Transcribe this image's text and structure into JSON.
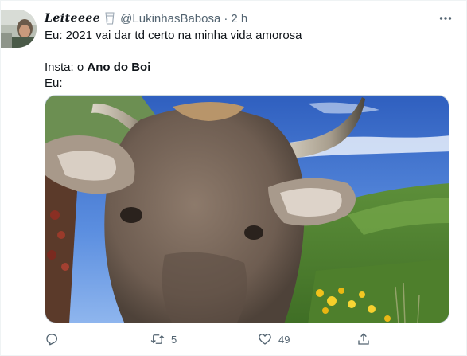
{
  "tweet": {
    "display_name": "Leiteeee",
    "handle": "@LukinhasBabosa",
    "separator": "·",
    "time": "2 h",
    "line1": "Eu: 2021 vai dar td certo na minha vida amorosa",
    "line2_prefix": "Insta: o ",
    "line2_bold": "Ano do Boi",
    "line3": "Eu:"
  },
  "icons": {
    "avatar": "avatar",
    "badge": "milk-cup-icon",
    "more": "more-horizontal-icon",
    "reply": "reply-icon",
    "retweet": "retweet-icon",
    "like": "heart-icon",
    "share": "share-icon"
  },
  "actions": {
    "reply_count": "",
    "retweet_count": "5",
    "like_count": "49"
  },
  "colors": {
    "text": "#0f1419",
    "secondary": "#536471",
    "border": "#eff3f4"
  }
}
